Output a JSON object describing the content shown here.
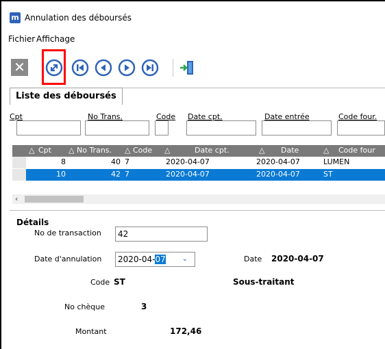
{
  "window": {
    "app_icon_letter": "m",
    "title": "Annulation des déboursés"
  },
  "menu": {
    "items": [
      "Fichier",
      "Affichage"
    ]
  },
  "toolbar": {
    "buttons": [
      "close-icon",
      "refresh-link-icon",
      "first-record-icon",
      "previous-record-icon",
      "next-record-icon",
      "last-record-icon",
      "exit-door-icon"
    ],
    "highlight_color": "#ff0000",
    "accent_color": "#2f63b8"
  },
  "list": {
    "tab_label": "Liste des déboursés",
    "filter_labels": [
      "Cpt",
      "No Trans.",
      "Code",
      "Date cpt.",
      "Date entrée",
      "Code four."
    ],
    "columns": [
      "Cpt",
      "No Trans.",
      "Code",
      "Date cpt.",
      "Date",
      "Code four"
    ],
    "rows": [
      {
        "cpt": "8",
        "no_trans": "40",
        "code": "7",
        "date_cpt": "2020-04-07",
        "date": "2020-04-07",
        "code_four": "LUMEN"
      },
      {
        "cpt": "10",
        "no_trans": "42",
        "code": "7",
        "date_cpt": "2020-04-07",
        "date": "2020-04-07",
        "code_four": "ST"
      }
    ],
    "selected_row_color": "#0a7ad4"
  },
  "details": {
    "section_label": "Détails",
    "no_transaction_label": "No de transaction",
    "no_transaction_value": "42",
    "date_annulation_label": "Date d'annulation",
    "date_annulation_prefix": "2020-04-",
    "date_annulation_selected": "07",
    "date_label": "Date",
    "date_value": "2020-04-07",
    "code_label": "Code",
    "code_value": "ST",
    "code_desc": "Sous-traitant",
    "no_cheque_label": "No chèque",
    "no_cheque_value": "3",
    "montant_label": "Montant",
    "montant_value": "172,46"
  }
}
